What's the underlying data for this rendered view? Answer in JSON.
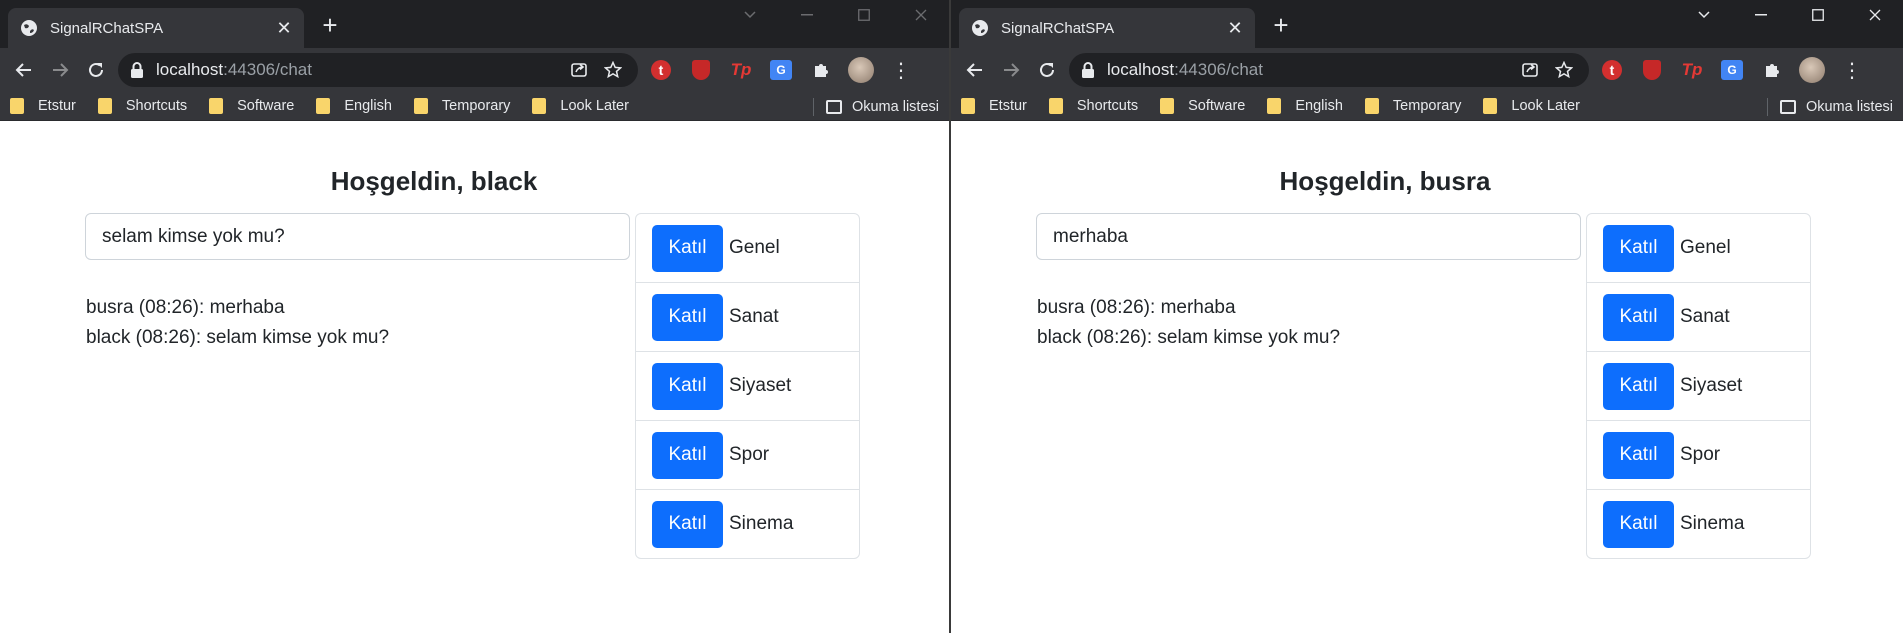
{
  "windows": [
    {
      "tab_title": "SignalRChatSPA",
      "url_host": "localhost",
      "url_rest": ":44306/chat",
      "bookmarks": [
        "Etstur",
        "Shortcuts",
        "Software",
        "English",
        "Temporary",
        "Look Later"
      ],
      "reading_list": "Okuma listesi",
      "greeting": "Hoşgeldin, black",
      "input_value": "selam kimse yok mu?",
      "messages": [
        "busra (08:26): merhaba",
        "black (08:26): selam kimse yok mu?"
      ],
      "rooms": [
        {
          "button": "Katıl",
          "name": "Genel"
        },
        {
          "button": "Katıl",
          "name": "Sanat"
        },
        {
          "button": "Katıl",
          "name": "Siyaset"
        },
        {
          "button": "Katıl",
          "name": "Spor"
        },
        {
          "button": "Katıl",
          "name": "Sinema"
        }
      ]
    },
    {
      "tab_title": "SignalRChatSPA",
      "url_host": "localhost",
      "url_rest": ":44306/chat",
      "bookmarks": [
        "Etstur",
        "Shortcuts",
        "Software",
        "English",
        "Temporary",
        "Look Later"
      ],
      "reading_list": "Okuma listesi",
      "greeting": "Hoşgeldin, busra",
      "input_value": "merhaba",
      "messages": [
        "busra (08:26): merhaba",
        "black (08:26): selam kimse yok mu?"
      ],
      "rooms": [
        {
          "button": "Katıl",
          "name": "Genel"
        },
        {
          "button": "Katıl",
          "name": "Sanat"
        },
        {
          "button": "Katıl",
          "name": "Siyaset"
        },
        {
          "button": "Katıl",
          "name": "Spor"
        },
        {
          "button": "Katıl",
          "name": "Sinema"
        }
      ]
    }
  ],
  "colors": {
    "join_button": "#0d6efd",
    "chrome_dark": "#202124",
    "chrome_toolbar": "#35363a",
    "bookmark_folder": "#f9d56b"
  },
  "icons": {
    "tab": "globe-icon",
    "lock": "lock-icon",
    "share": "share-icon",
    "star": "star-icon",
    "extensions": "puzzle-icon"
  }
}
